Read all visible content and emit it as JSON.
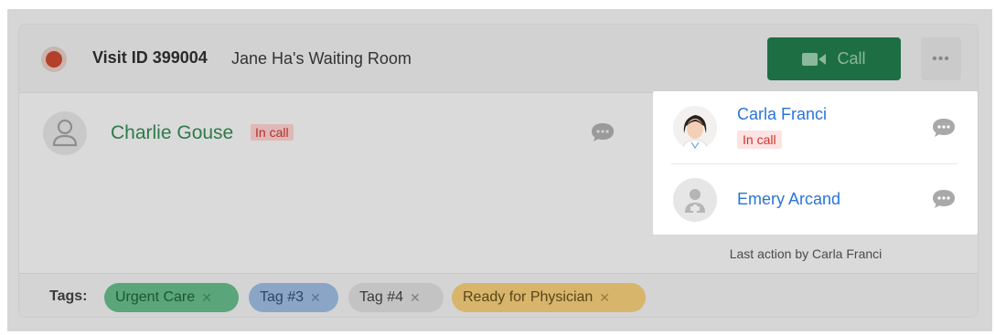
{
  "header": {
    "visit_id": "Visit ID 399004",
    "room_name": "Jane Ha's Waiting Room",
    "call_label": "Call",
    "more_label": "•••"
  },
  "patient": {
    "name": "Charlie Gouse",
    "status": "In call"
  },
  "participants": [
    {
      "name": "Carla Franci",
      "status": "In call"
    },
    {
      "name": "Emery Arcand"
    }
  ],
  "last_action": "Last action by Carla Franci",
  "tags": {
    "label": "Tags:",
    "items": [
      "Urgent Care",
      "Tag #3",
      "Tag #4",
      "Ready for Physician"
    ],
    "remove_glyph": "✕"
  },
  "colors": {
    "call_button": "#1e6e44",
    "in_call_badge_text": "#d5322a",
    "participant_link": "#2b74d8",
    "tag_urgent": "#5aa57a",
    "tag_3": "#8ba5c6",
    "tag_4": "#c3c3c3",
    "tag_ready": "#d7b56b"
  },
  "icons": {
    "status": "recording-dot-icon",
    "call": "video-camera-icon",
    "more": "more-dots-icon",
    "patient_avatar": "user-icon",
    "chat": "chat-bubble-icon",
    "provider_avatar": "doctor-icon"
  }
}
